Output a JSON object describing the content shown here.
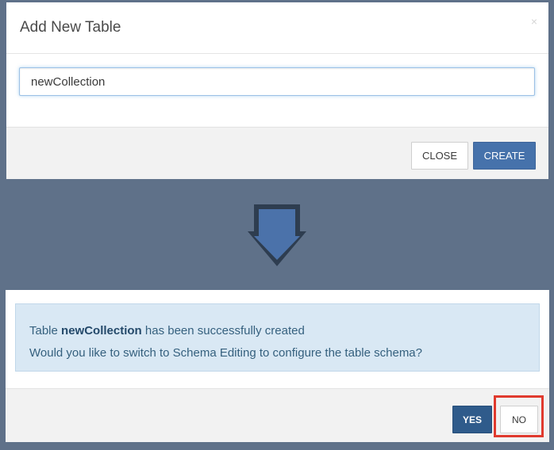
{
  "top_dialog": {
    "title": "Add New Table",
    "close_icon": "×",
    "input_value": "newCollection",
    "close_label": "CLOSE",
    "create_label": "CREATE"
  },
  "arrow": {
    "icon": "down-arrow-icon",
    "color": "#4b72aa"
  },
  "bottom_dialog": {
    "message_prefix": "Table ",
    "table_name": "newCollection",
    "message_suffix": " has been successfully created",
    "question": "Would you like to switch to Schema Editing to configure the table schema?",
    "yes_label": "YES",
    "no_label": "NO",
    "highlight_color": "#e03a2e"
  },
  "colors": {
    "background": "#5f7189",
    "primary": "#4672ab",
    "alert_bg": "#d9e8f4",
    "alert_text": "#35607e"
  }
}
